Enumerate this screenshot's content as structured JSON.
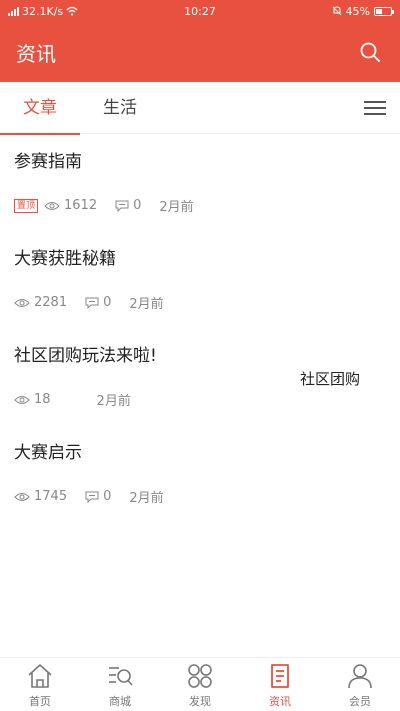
{
  "status": {
    "network_speed": "32.1K/s",
    "time": "10:27",
    "battery_percent": "45%",
    "battery_level": 0.45
  },
  "header": {
    "title": "资讯"
  },
  "tabs": [
    {
      "label": "文章",
      "active": true
    },
    {
      "label": "生活",
      "active": false
    }
  ],
  "articles": [
    {
      "title": "参赛指南",
      "badge": "置顶",
      "views": "1612",
      "comments": "0",
      "time": "2月前"
    },
    {
      "title": "大赛获胜秘籍",
      "views": "2281",
      "comments": "0",
      "time": "2月前"
    },
    {
      "title": "社区团购玩法来啦!",
      "views": "18",
      "time": "2月前"
    },
    {
      "title": "大赛启示",
      "views": "1745",
      "comments": "0",
      "time": "2月前"
    }
  ],
  "side_label": "社区团购",
  "bottom_nav": [
    {
      "label": "首页",
      "icon": "home-icon",
      "active": false
    },
    {
      "label": "商城",
      "icon": "shop-search-icon",
      "active": false
    },
    {
      "label": "发现",
      "icon": "discover-icon",
      "active": false
    },
    {
      "label": "资讯",
      "icon": "news-icon",
      "active": true
    },
    {
      "label": "会员",
      "icon": "user-icon",
      "active": false
    }
  ],
  "colors": {
    "accent": "#e8513f",
    "text": "#222222",
    "meta": "#888888"
  }
}
